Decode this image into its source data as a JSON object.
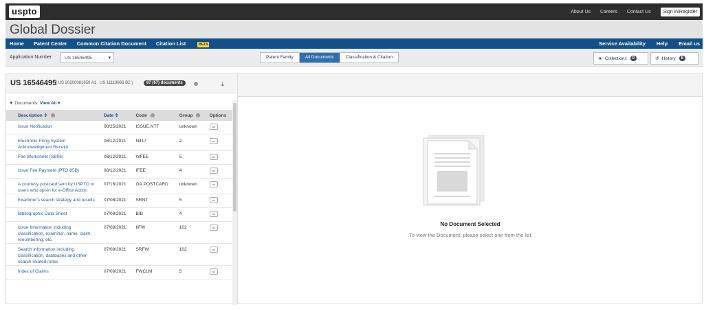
{
  "topbar": {
    "logo": "uspto",
    "links": [
      "About Us",
      "Careers",
      "Contact Us"
    ],
    "signin": "Sign in/Register"
  },
  "app_title": "Global Dossier",
  "nav": {
    "left": [
      "Home",
      "Patent Center",
      "Common Citation Document",
      "Citation List"
    ],
    "beta": "BETA",
    "right": [
      "Service Availability",
      "Help",
      "Email us"
    ]
  },
  "app_row": {
    "label": "Application Number",
    "selected": "US 16546495",
    "segments": [
      "Patent Family",
      "All Documents",
      "Classification & Citation"
    ],
    "collections_label": "Collections",
    "collections_count": "0",
    "history_label": "History",
    "history_count": "8"
  },
  "left_panel": {
    "app_number": "US 16546495",
    "sub": "( US 20200081650 A1 , US 11119966 B2 )",
    "doc_count": "67 (67) documents",
    "filter_label": "Documents:",
    "view_all": "View All",
    "columns": [
      "Description",
      "Date",
      "Code",
      "Group",
      "Options"
    ],
    "rows": [
      {
        "desc": "Issue Notification",
        "date": "08/25/2021",
        "code": "ISSUE.NTF",
        "group": "unknown"
      },
      {
        "desc": "Electronic Filing System Acknowledgment Receipt",
        "date": "08/12/2021",
        "code": "N417",
        "group": "2"
      },
      {
        "desc": "Fee Worksheet (SB06)",
        "date": "08/12/2021",
        "code": "WFEE",
        "group": "5"
      },
      {
        "desc": "Issue Fee Payment (PTO-85B)",
        "date": "08/12/2021",
        "code": "IFEE",
        "group": "4"
      },
      {
        "desc": "A courtesy postcard sent by USPTO to users who opt-in for e-Office Action",
        "date": "07/16/2021",
        "code": "OA.POSTCARD",
        "group": "unknown"
      },
      {
        "desc": "Examiner's search strategy and results",
        "date": "07/08/2021",
        "code": "SRNT",
        "group": "5"
      },
      {
        "desc": "Bibliographic Data Sheet",
        "date": "07/08/2021",
        "code": "BIB",
        "group": "4"
      },
      {
        "desc": "Issue Information including classification, examiner, name, claim, renumbering, etc.",
        "date": "07/08/2021",
        "code": "IIFW",
        "group": "102"
      },
      {
        "desc": "Search information including classification, databases and other search related notes",
        "date": "07/08/2021",
        "code": "SRFW",
        "group": "102"
      },
      {
        "desc": "Index of Claims",
        "date": "07/08/2021",
        "code": "FWCLM",
        "group": "5"
      }
    ]
  },
  "viewer": {
    "empty_title": "No Document Selected",
    "empty_sub": "To view the Document, please select one from the list"
  },
  "colors": {
    "nav_blue": "#12508a",
    "active_segment": "#2e6fb0",
    "link_blue": "#2b5ea3",
    "topbar": "#2d2d2d"
  }
}
